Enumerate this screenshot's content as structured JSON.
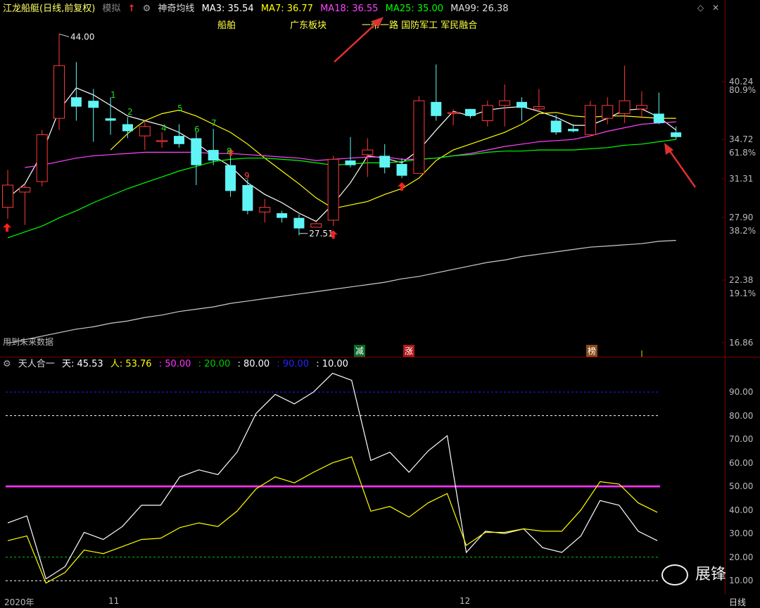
{
  "header": {
    "stock_title": "江龙船艇(日线,前复权)",
    "mode": "模拟",
    "indicator_name": "神奇均线",
    "ma": [
      {
        "label": "MA3: 35.54",
        "color": "#ffffff"
      },
      {
        "label": "MA7: 36.77",
        "color": "#ffff00"
      },
      {
        "label": "MA18: 36.55",
        "color": "#ff44ff"
      },
      {
        "label": "MA25: 35.00",
        "color": "#00ff00"
      },
      {
        "label": "MA99: 26.38",
        "color": "#dddddd"
      }
    ]
  },
  "tags": [
    "船舶",
    "广东板块",
    "一带一路 国防军工 军民融合"
  ],
  "note": "用到未来数据",
  "badges": [
    {
      "text": "减",
      "color": "#0a6a2a"
    },
    {
      "text": "涨",
      "color": "#b01818"
    },
    {
      "text": "榜",
      "color": "#8a4a1a"
    }
  ],
  "indicator": {
    "name": "天人合一",
    "values": [
      {
        "label": "天: 45.53",
        "color": "#ffffff"
      },
      {
        "label": "人: 53.76",
        "color": "#ffff00"
      },
      {
        "label": ": 50.00",
        "color": "#ff33ff"
      },
      {
        "label": ": 20.00",
        "color": "#00cc00"
      },
      {
        "label": ": 80.00",
        "color": "#ffffff"
      },
      {
        "label": ": 90.00",
        "color": "#2222ff"
      },
      {
        "label": ": 10.00",
        "color": "#ffffff"
      }
    ]
  },
  "x_labels": [
    "2020年",
    "11",
    "12"
  ],
  "x_axis_period": "日线",
  "watermark": "展锋",
  "chart_data": [
    {
      "type": "candlestick",
      "title": "江龙船艇(日线,前复权)",
      "y_ticks_price": [
        "40.24",
        "34.72",
        "31.31",
        "27.90",
        "22.38",
        "16.86"
      ],
      "y_ticks_pct": [
        "80.9%",
        "61.8%",
        "38.2%",
        "19.1%"
      ],
      "ylim": [
        16.86,
        44.5
      ],
      "annotations": [
        {
          "text": "44.00",
          "type": "high"
        },
        {
          "text": "27.51",
          "type": "low"
        }
      ],
      "count_labels": [
        "1",
        "2",
        "4",
        "5",
        "6",
        "7",
        "8",
        "9"
      ],
      "candles": [
        {
          "o": 29.2,
          "h": 32.4,
          "l": 28.2,
          "c": 31.1
        },
        {
          "o": 30.5,
          "h": 31.2,
          "l": 27.7,
          "c": 30.9
        },
        {
          "o": 31.4,
          "h": 35.8,
          "l": 31.0,
          "c": 35.4
        },
        {
          "o": 36.8,
          "h": 44.0,
          "l": 35.8,
          "c": 41.3
        },
        {
          "o": 38.6,
          "h": 41.6,
          "l": 36.6,
          "c": 37.8
        },
        {
          "o": 38.3,
          "h": 39.3,
          "l": 34.8,
          "c": 37.7
        },
        {
          "o": 36.8,
          "h": 38.6,
          "l": 35.4,
          "c": 36.6
        },
        {
          "o": 36.3,
          "h": 36.9,
          "l": 35.1,
          "c": 35.7
        },
        {
          "o": 35.3,
          "h": 36.6,
          "l": 34.1,
          "c": 36.1
        },
        {
          "o": 34.9,
          "h": 35.6,
          "l": 34.3,
          "c": 34.9
        },
        {
          "o": 35.3,
          "h": 36.3,
          "l": 34.3,
          "c": 34.6
        },
        {
          "o": 35.1,
          "h": 35.6,
          "l": 31.1,
          "c": 32.8
        },
        {
          "o": 34.1,
          "h": 35.9,
          "l": 32.8,
          "c": 33.2
        },
        {
          "o": 32.8,
          "h": 33.6,
          "l": 30.1,
          "c": 30.6
        },
        {
          "o": 31.1,
          "h": 31.6,
          "l": 28.6,
          "c": 28.9
        },
        {
          "o": 28.8,
          "h": 29.9,
          "l": 27.9,
          "c": 29.2
        },
        {
          "o": 28.7,
          "h": 28.9,
          "l": 27.9,
          "c": 28.3
        },
        {
          "o": 28.3,
          "h": 28.6,
          "l": 26.8,
          "c": 27.4
        },
        {
          "o": 27.5,
          "h": 27.9,
          "l": 27.51,
          "c": 27.8
        },
        {
          "o": 28.1,
          "h": 33.6,
          "l": 27.6,
          "c": 33.3
        },
        {
          "o": 33.2,
          "h": 35.2,
          "l": 32.6,
          "c": 32.8
        },
        {
          "o": 33.7,
          "h": 35.1,
          "l": 31.8,
          "c": 34.1
        },
        {
          "o": 33.6,
          "h": 34.6,
          "l": 32.1,
          "c": 32.6
        },
        {
          "o": 32.9,
          "h": 33.4,
          "l": 31.7,
          "c": 31.9
        },
        {
          "o": 32.1,
          "h": 38.7,
          "l": 32.1,
          "c": 38.3
        },
        {
          "o": 38.2,
          "h": 41.4,
          "l": 36.6,
          "c": 37.0
        },
        {
          "o": 37.2,
          "h": 37.6,
          "l": 36.2,
          "c": 37.3
        },
        {
          "o": 37.6,
          "h": 37.6,
          "l": 36.8,
          "c": 37.0
        },
        {
          "o": 36.6,
          "h": 38.3,
          "l": 36.1,
          "c": 37.9
        },
        {
          "o": 37.9,
          "h": 39.7,
          "l": 36.1,
          "c": 38.3
        },
        {
          "o": 38.2,
          "h": 38.6,
          "l": 36.6,
          "c": 37.7
        },
        {
          "o": 37.6,
          "h": 39.3,
          "l": 37.3,
          "c": 37.8
        },
        {
          "o": 36.6,
          "h": 37.1,
          "l": 35.4,
          "c": 35.6
        },
        {
          "o": 35.9,
          "h": 36.3,
          "l": 35.6,
          "c": 35.7
        },
        {
          "o": 35.4,
          "h": 38.3,
          "l": 35.4,
          "c": 37.9
        },
        {
          "o": 36.8,
          "h": 38.6,
          "l": 36.3,
          "c": 37.9
        },
        {
          "o": 37.2,
          "h": 41.3,
          "l": 36.4,
          "c": 38.3
        },
        {
          "o": 37.6,
          "h": 39.1,
          "l": 36.8,
          "c": 37.9
        },
        {
          "o": 37.2,
          "h": 39.0,
          "l": 36.3,
          "c": 36.4
        },
        {
          "o": 35.6,
          "h": 36.1,
          "l": 35.0,
          "c": 35.2
        }
      ],
      "series": [
        {
          "name": "MA3",
          "color": "#ffffff",
          "values": [
            30.0,
            31.2,
            33.8,
            37.5,
            39.4,
            38.8,
            37.9,
            37.0,
            36.6,
            36.2,
            35.6,
            34.7,
            33.6,
            32.7,
            31.3,
            30.3,
            29.6,
            28.7,
            28.0,
            29.5,
            31.3,
            33.6,
            33.4,
            33.0,
            34.1,
            35.8,
            37.4,
            37.0,
            37.5,
            37.7,
            37.8,
            37.4,
            36.9,
            36.2,
            36.2,
            36.8,
            37.5,
            37.6,
            36.9,
            35.8
          ]
        },
        {
          "name": "MA7",
          "color": "#ffff00",
          "values": [
            null,
            null,
            null,
            null,
            null,
            null,
            34.1,
            35.5,
            36.6,
            37.2,
            37.5,
            37.0,
            36.3,
            35.6,
            34.6,
            33.4,
            32.3,
            31.2,
            30.0,
            29.1,
            29.4,
            29.7,
            30.3,
            30.8,
            31.7,
            33.2,
            34.1,
            34.6,
            35.1,
            35.6,
            36.3,
            37.2,
            37.3,
            37.0,
            36.9,
            37.0,
            37.0,
            36.9,
            36.8,
            36.8
          ]
        },
        {
          "name": "MA18",
          "color": "#ff44ff",
          "values": [
            null,
            32.6,
            32.8,
            33.1,
            33.4,
            33.6,
            33.7,
            33.8,
            33.9,
            33.9,
            33.9,
            33.9,
            33.8,
            33.8,
            33.7,
            33.6,
            33.5,
            33.4,
            33.2,
            33.3,
            33.4,
            33.5,
            33.5,
            33.3,
            33.3,
            33.4,
            33.6,
            33.8,
            34.1,
            34.4,
            34.6,
            34.8,
            34.9,
            35.0,
            35.3,
            35.7,
            36.0,
            36.3,
            36.4,
            36.5
          ]
        },
        {
          "name": "MA25",
          "color": "#00ff00",
          "values": [
            26.6,
            27.1,
            27.6,
            28.3,
            28.9,
            29.6,
            30.2,
            30.8,
            31.3,
            31.8,
            32.3,
            32.7,
            33.1,
            33.3,
            33.4,
            33.4,
            33.3,
            33.2,
            33.0,
            32.8,
            32.9,
            33.0,
            33.0,
            33.1,
            33.3,
            33.4,
            33.6,
            33.7,
            33.9,
            34.0,
            34.0,
            34.1,
            34.1,
            34.1,
            34.2,
            34.3,
            34.5,
            34.6,
            34.8,
            35.0
          ]
        },
        {
          "name": "MA99",
          "color": "#cccccc",
          "values": [
            17.6,
            17.9,
            18.2,
            18.5,
            18.8,
            19.0,
            19.3,
            19.5,
            19.8,
            20.0,
            20.3,
            20.5,
            20.7,
            21.0,
            21.2,
            21.4,
            21.6,
            21.8,
            22.0,
            22.2,
            22.4,
            22.6,
            22.8,
            23.1,
            23.3,
            23.6,
            23.9,
            24.2,
            24.5,
            24.7,
            25.0,
            25.2,
            25.4,
            25.6,
            25.8,
            25.9,
            26.0,
            26.1,
            26.3,
            26.38
          ]
        }
      ]
    },
    {
      "type": "line",
      "title": "天人合一",
      "y_ticks": [
        "90.00",
        "80.00",
        "70.00",
        "60.00",
        "50.00",
        "40.00",
        "30.00",
        "20.00",
        "10.00"
      ],
      "ylim": [
        5,
        99
      ],
      "reference_lines": [
        {
          "value": 90,
          "color": "#2222ff",
          "dashed": true
        },
        {
          "value": 80,
          "color": "#ffffff",
          "dashed": true
        },
        {
          "value": 50,
          "color": "#ff33ff",
          "dashed": false
        },
        {
          "value": 20,
          "color": "#00cc00",
          "dashed": true
        },
        {
          "value": 10,
          "color": "#ffffff",
          "dashed": true
        }
      ],
      "x": [
        0,
        1.5,
        3,
        4.5,
        6,
        7.5,
        9,
        10.5,
        12,
        13.5,
        15,
        16.5,
        18,
        19.5,
        21,
        22.5,
        24,
        25.5,
        27,
        28.5,
        30,
        31.5,
        33,
        34.5,
        36,
        37.5,
        39,
        40.5,
        42,
        43.5,
        45,
        46.5,
        48,
        49.5,
        51
      ],
      "series": [
        {
          "name": "天",
          "color": "#ffffff",
          "values": [
            34.5,
            37.5,
            10.8,
            16.0,
            30.5,
            27.5,
            33.0,
            42.0,
            42.0,
            54.0,
            57.0,
            55.0,
            64.5,
            81.0,
            89.0,
            85.0,
            90.0,
            98.0,
            95.0,
            61.0,
            64.5,
            56.0,
            65.0,
            71.5,
            22.0,
            31.0,
            30.0,
            32.0,
            24.0,
            22.0,
            29.0,
            44.0,
            42.0,
            31.0,
            27.0
          ]
        },
        {
          "name": "人",
          "color": "#ffff00",
          "values": [
            27.0,
            29.0,
            9.0,
            13.5,
            23.0,
            21.5,
            24.5,
            27.5,
            28.0,
            32.5,
            34.5,
            33.0,
            39.5,
            49.0,
            54.0,
            51.5,
            56.0,
            60.0,
            62.5,
            39.5,
            41.5,
            37.0,
            43.0,
            47.0,
            25.0,
            30.5,
            30.5,
            32.0,
            31.0,
            31.0,
            40.0,
            52.0,
            51.0,
            43.0,
            39.0
          ]
        }
      ]
    }
  ]
}
